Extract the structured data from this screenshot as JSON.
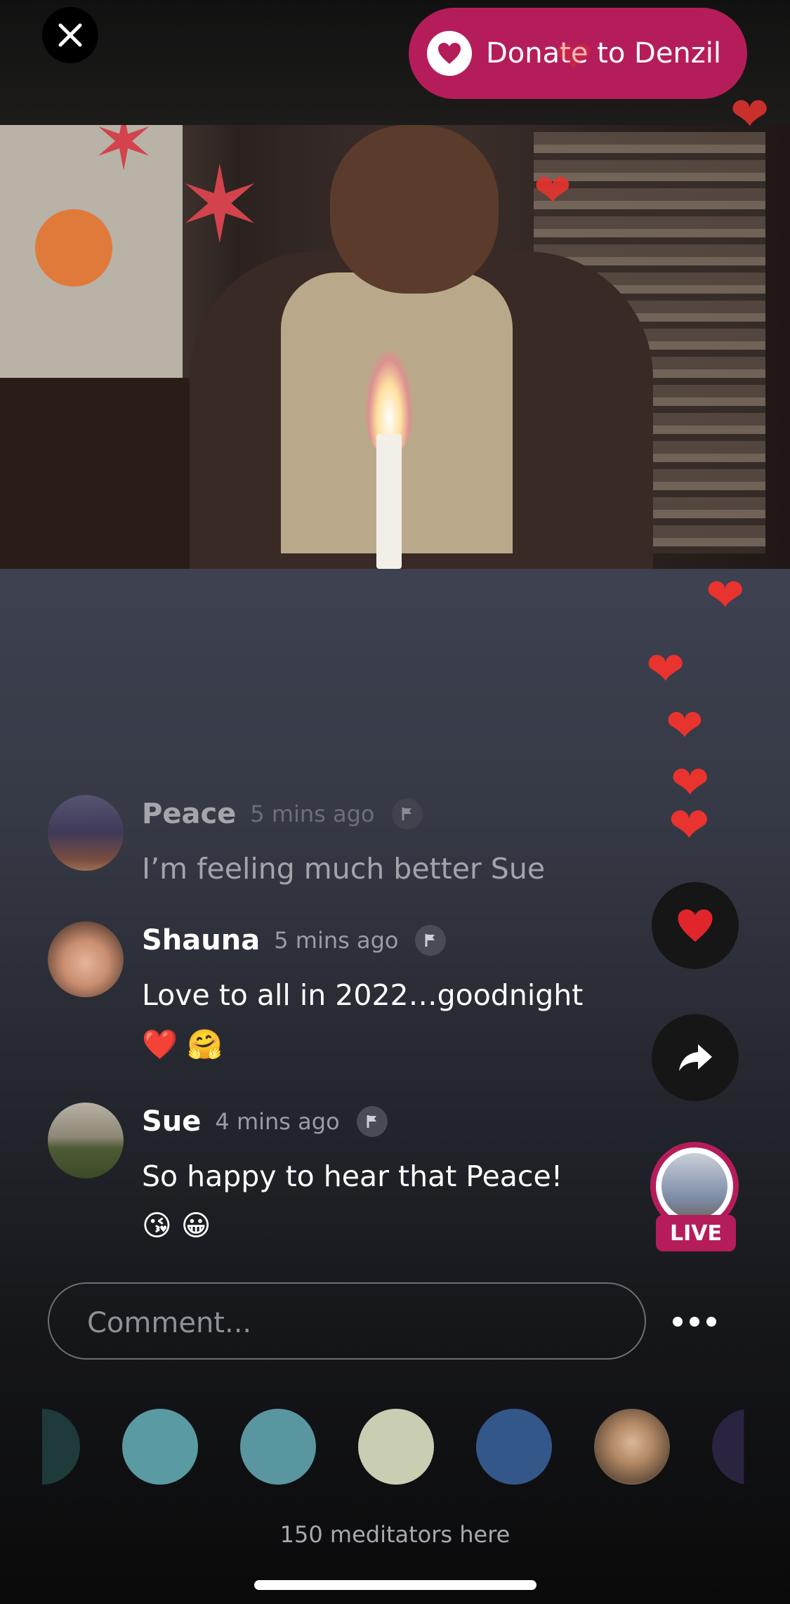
{
  "header": {
    "close_icon": "close-icon",
    "donate_label": "Donate to Denzil",
    "donate_icon": "heart-icon",
    "accent_color": "#b51d5a"
  },
  "comments": [
    {
      "name": "Peace",
      "time": "5 mins ago",
      "text": "I’m feeling much better Sue",
      "faded": true
    },
    {
      "name": "Shauna",
      "time": "5 mins ago",
      "text": "Love to all in 2022…goodnight",
      "emoji": "❤️ 🤗"
    },
    {
      "name": "Sue",
      "time": "4 mins ago",
      "text": "So happy to hear that Peace!",
      "emoji": "😘 😀"
    }
  ],
  "actions": {
    "heart_icon": "heart-icon",
    "share_icon": "share-icon"
  },
  "live": {
    "badge": "LIVE"
  },
  "comment_input": {
    "placeholder": "Comment..."
  },
  "more_icon": "more-icon",
  "meditators": {
    "avatar_colors": [
      "#1e3a3a",
      "#5a9aa3",
      "#5a96a0",
      "#c9cdb2",
      "#34578a",
      "#9b7b5e",
      "#2a2440"
    ],
    "count_text": "150 meditators here"
  }
}
